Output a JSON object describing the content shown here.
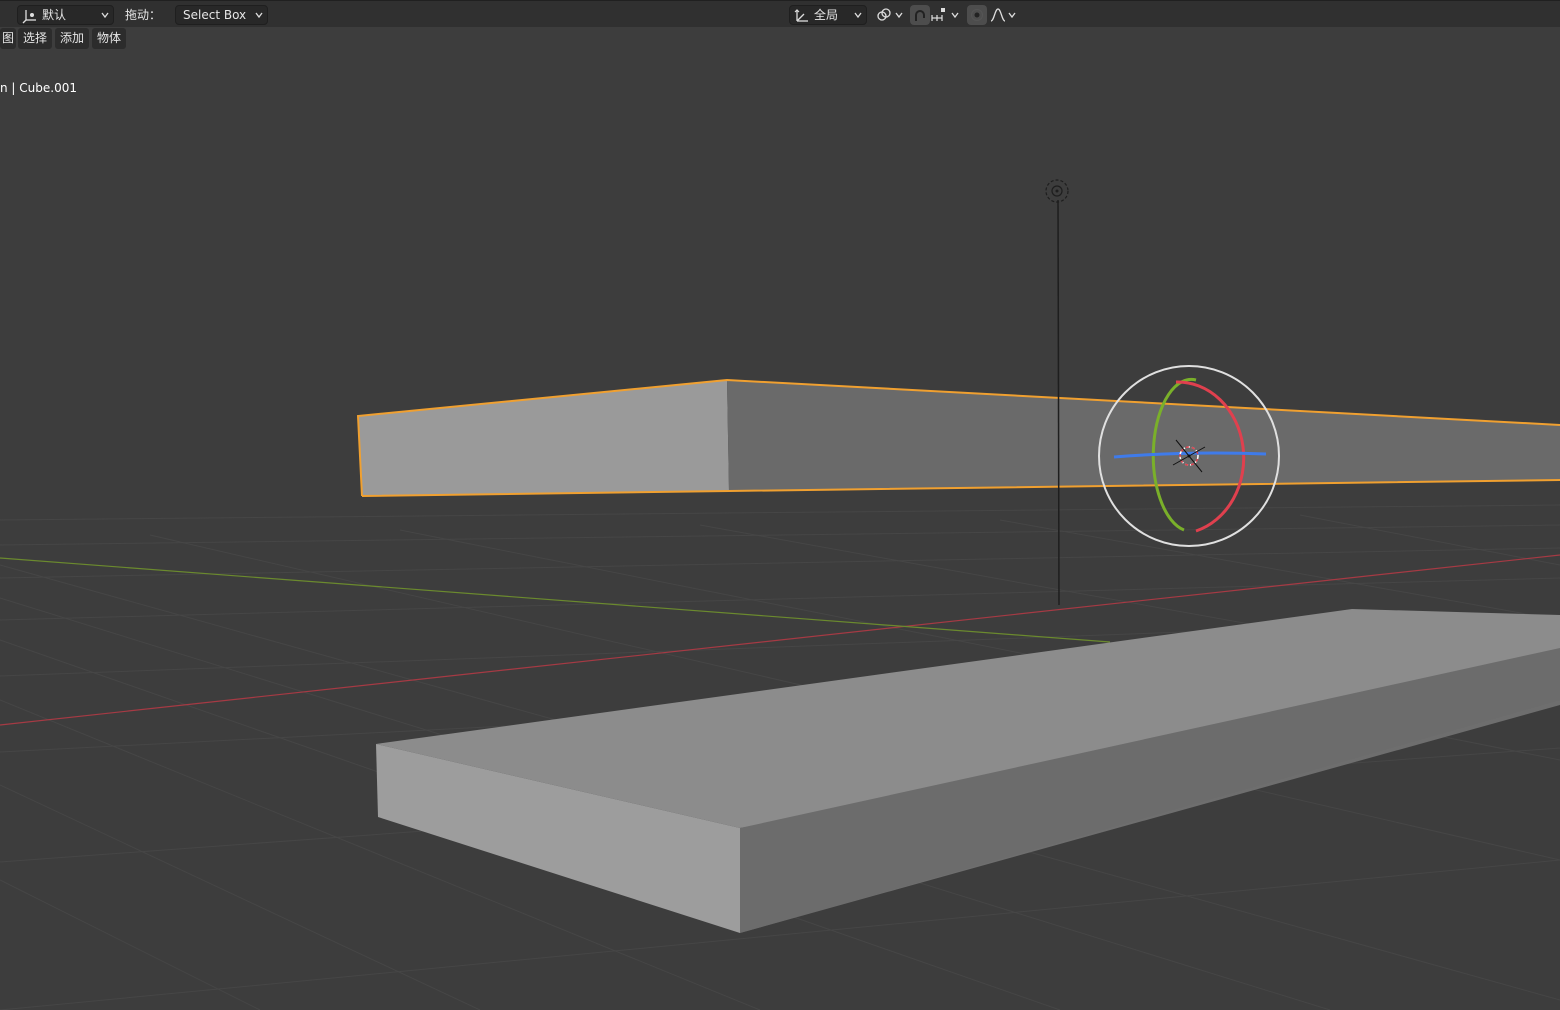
{
  "header": {
    "mode_dropdown": {
      "value": "默认",
      "icon": "transform-orientation-icon"
    },
    "drag_label": "拖动：",
    "drag_dropdown": {
      "value": "Select Box"
    },
    "orientation_dropdown": {
      "value": "全局",
      "icon": "orientation-axes-icon"
    },
    "pivot_icon": "pivot-link-icon",
    "snap_icon": "snap-magnet-icon",
    "snap_target_icon": "snap-increment-icon",
    "proportional_icon": "proportional-edit-icon",
    "falloff_icon": "falloff-curve-icon"
  },
  "menu": {
    "items": [
      {
        "label": "图"
      },
      {
        "label": "选择"
      },
      {
        "label": "添加"
      },
      {
        "label": "物体"
      }
    ]
  },
  "viewport": {
    "object_info": "n | Cube.001",
    "colors": {
      "background": "#3d3d3d",
      "grid_line": "#4a4a4a",
      "x_axis": "#a63a44",
      "y_axis": "#6b8a2e",
      "selection_outline": "#f0a030",
      "gizmo_x": "#e0404e",
      "gizmo_y": "#7ab02a",
      "gizmo_z": "#3f7bea",
      "gizmo_ring": "#e0e0e0"
    },
    "icons": [
      "light-object-icon",
      "rotate-gizmo-icon",
      "object-origin-icon"
    ]
  }
}
